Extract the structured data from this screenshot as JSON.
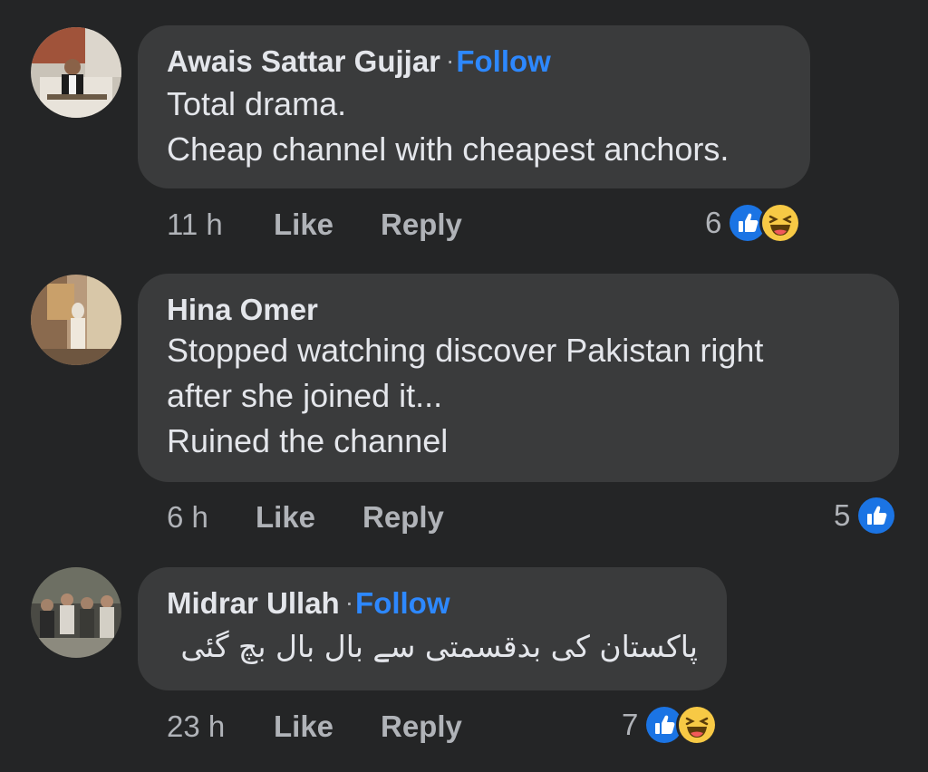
{
  "comments": [
    {
      "author": "Awais Sattar Gujjar",
      "follow_label": "Follow",
      "lines": [
        "Total drama.",
        "Cheap channel with cheapest anchors."
      ],
      "time": "11 h",
      "like_label": "Like",
      "reply_label": "Reply",
      "reaction_count": "6",
      "reactions": [
        "like-icon",
        "haha-icon"
      ]
    },
    {
      "author": "Hina Omer",
      "lines": [
        "Stopped watching discover Pakistan right",
        "after she joined it...",
        "Ruined the channel"
      ],
      "time": "6 h",
      "like_label": "Like",
      "reply_label": "Reply",
      "reaction_count": "5",
      "reactions": [
        "like-icon"
      ]
    },
    {
      "author": "Midrar Ullah",
      "follow_label": "Follow",
      "lines": [
        "پاکستان کی بدقسمتی سے بال بال بچ گئی"
      ],
      "time": "23 h",
      "like_label": "Like",
      "reply_label": "Reply",
      "reaction_count": "7",
      "reactions": [
        "like-icon",
        "haha-icon"
      ]
    }
  ],
  "colors": {
    "background": "#242526",
    "bubble": "#3a3b3c",
    "follow_blue": "#2d88ff",
    "like_blue": "#1b74e4",
    "haha_yellow": "#f7c945"
  }
}
